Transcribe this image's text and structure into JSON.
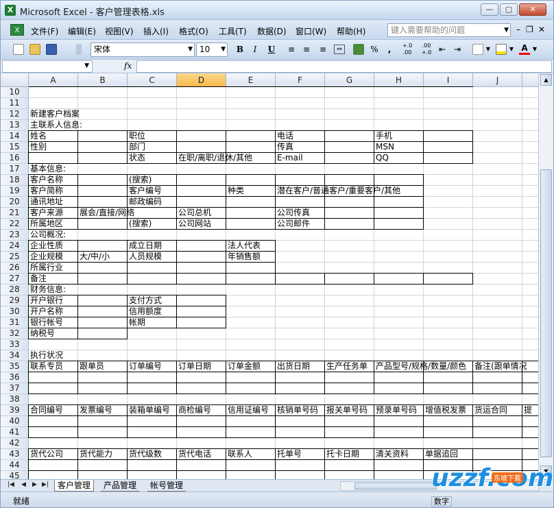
{
  "window": {
    "title": "Microsoft Excel - 客户管理表格.xls",
    "app_icon": "excel-icon"
  },
  "menu": {
    "items": [
      "文件(F)",
      "编辑(E)",
      "视图(V)",
      "插入(I)",
      "格式(O)",
      "工具(T)",
      "数据(D)",
      "窗口(W)",
      "帮助(H)"
    ],
    "help_placeholder": "键入需要帮助的问题"
  },
  "toolbar": {
    "font_name": "宋体",
    "font_size": "10",
    "bold": "B",
    "italic": "I",
    "underline": "U",
    "percent": "%",
    "comma": ",",
    "inc_decimal": "+.0 .00",
    "dec_decimal": ".00 +.0"
  },
  "formula_bar": {
    "name_box": "",
    "fx_label": "fx",
    "value": ""
  },
  "columns": [
    {
      "label": "A",
      "width": 72
    },
    {
      "label": "B",
      "width": 72
    },
    {
      "label": "C",
      "width": 72
    },
    {
      "label": "D",
      "width": 72
    },
    {
      "label": "E",
      "width": 72
    },
    {
      "label": "F",
      "width": 72
    },
    {
      "label": "G",
      "width": 72
    },
    {
      "label": "H",
      "width": 72
    },
    {
      "label": "I",
      "width": 72
    },
    {
      "label": "J",
      "width": 72
    },
    {
      "label": "",
      "width": 30
    }
  ],
  "selected_column": "D",
  "rows": [
    {
      "n": "10",
      "cells": {}
    },
    {
      "n": "11",
      "cells": {}
    },
    {
      "n": "12",
      "cells": {
        "A": "新建客户档案"
      }
    },
    {
      "n": "13",
      "cells": {
        "A": "主联系人信息:"
      }
    },
    {
      "n": "14",
      "cells": {
        "A": "姓名",
        "C": "职位",
        "F": "电话",
        "H": "手机"
      }
    },
    {
      "n": "15",
      "cells": {
        "A": "性别",
        "C": "部门",
        "F": "传真",
        "H": "MSN"
      }
    },
    {
      "n": "16",
      "cells": {
        "C": "状态",
        "D": "在职/离职/退休/其他",
        "F": "E-mail",
        "H": "QQ"
      }
    },
    {
      "n": "17",
      "cells": {
        "A": "基本信息:"
      }
    },
    {
      "n": "18",
      "cells": {
        "A": "客户名称",
        "C": "(搜索)"
      }
    },
    {
      "n": "19",
      "cells": {
        "A": "客户简称",
        "C": "客户编号",
        "E": "种类",
        "F": "潜在客户/普通客户/重要客户/其他"
      }
    },
    {
      "n": "20",
      "cells": {
        "A": "通讯地址",
        "C": "邮政编码"
      }
    },
    {
      "n": "21",
      "cells": {
        "A": "客户来源",
        "B": "展会/直接/网络",
        "D": "公司总机",
        "F": "公司传真"
      }
    },
    {
      "n": "22",
      "cells": {
        "A": "所属地区",
        "C": "(搜索)",
        "D": "公司网站",
        "F": "公司邮件"
      }
    },
    {
      "n": "23",
      "cells": {
        "A": "公司概况:"
      }
    },
    {
      "n": "24",
      "cells": {
        "A": "企业性质",
        "C": "成立日期",
        "E": "法人代表"
      }
    },
    {
      "n": "25",
      "cells": {
        "A": "企业规模",
        "B": "大/中/小",
        "C": "人员规模",
        "E": "年销售额"
      }
    },
    {
      "n": "26",
      "cells": {
        "A": "所属行业"
      }
    },
    {
      "n": "27",
      "cells": {
        "A": "备注"
      }
    },
    {
      "n": "28",
      "cells": {
        "A": "财务信息:"
      }
    },
    {
      "n": "29",
      "cells": {
        "A": "开户银行",
        "C": "支付方式"
      }
    },
    {
      "n": "30",
      "cells": {
        "A": "开户名称",
        "C": "信用额度"
      }
    },
    {
      "n": "31",
      "cells": {
        "A": "银行帐号",
        "C": "帐期"
      }
    },
    {
      "n": "32",
      "cells": {
        "A": "纳税号"
      }
    },
    {
      "n": "33",
      "cells": {}
    },
    {
      "n": "34",
      "cells": {
        "A": "执行状况"
      }
    },
    {
      "n": "35",
      "cells": {
        "A": "联系专员",
        "B": "跟单员",
        "C": "订单编号",
        "D": "订单日期",
        "E": "订单金额",
        "F": "出货日期",
        "G": "生产任务单",
        "H": "产品型号/规格/数量/颜色",
        "J": "备注(跟单情况"
      }
    },
    {
      "n": "36",
      "cells": {}
    },
    {
      "n": "37",
      "cells": {}
    },
    {
      "n": "38",
      "cells": {}
    },
    {
      "n": "39",
      "cells": {
        "A": "合同编号",
        "B": "发票编号",
        "C": "装箱单编号",
        "D": "商检编号",
        "E": "信用证编号",
        "F": "核销单号码",
        "G": "报关单号码",
        "H": "预录单号码",
        "I": "增值税发票",
        "J": "货运合同",
        "K": "提"
      }
    },
    {
      "n": "40",
      "cells": {}
    },
    {
      "n": "41",
      "cells": {}
    },
    {
      "n": "42",
      "cells": {}
    },
    {
      "n": "43",
      "cells": {
        "A": "货代公司",
        "B": "货代能力",
        "C": "货代级数",
        "D": "货代电话",
        "E": "联系人",
        "F": "托单号",
        "G": "托卡日期",
        "H": "清关资料",
        "I": "单据追回"
      }
    },
    {
      "n": "44",
      "cells": {}
    },
    {
      "n": "45",
      "cells": {}
    }
  ],
  "sheet_tabs": [
    "客户管理",
    "产品管理",
    "帐号管理"
  ],
  "active_tab": "客户管理",
  "status": {
    "ready": "就绪",
    "mode": "数字"
  },
  "watermark": {
    "logo": "uzzf.com",
    "tag": "东坡下载"
  }
}
